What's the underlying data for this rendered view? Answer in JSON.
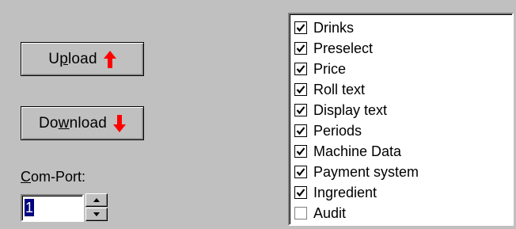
{
  "buttons": {
    "upload": {
      "label_pre": "U",
      "label_ul": "p",
      "label_post": "load",
      "icon": "arrow-up-icon"
    },
    "download": {
      "label_pre": "Do",
      "label_ul": "w",
      "label_post": "nload",
      "icon": "arrow-down-icon"
    }
  },
  "comport": {
    "label_ul": "C",
    "label_post": "om-Port:",
    "value": "1"
  },
  "colors": {
    "arrow": "#ff0000",
    "selection": "#000080",
    "face": "#c0c0c0"
  },
  "list": {
    "items": [
      {
        "label": "Drinks",
        "checked": true
      },
      {
        "label": "Preselect",
        "checked": true
      },
      {
        "label": "Price",
        "checked": true
      },
      {
        "label": "Roll text",
        "checked": true
      },
      {
        "label": "Display text",
        "checked": true
      },
      {
        "label": "Periods",
        "checked": true
      },
      {
        "label": "Machine Data",
        "checked": true
      },
      {
        "label": "Payment system",
        "checked": true
      },
      {
        "label": "Ingredient",
        "checked": true
      },
      {
        "label": "Audit",
        "checked": false
      }
    ]
  }
}
